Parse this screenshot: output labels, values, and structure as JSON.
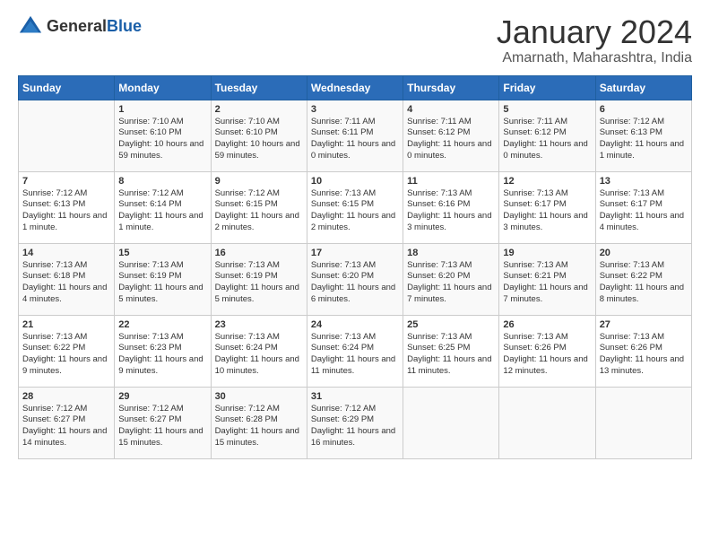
{
  "header": {
    "logo_line1": "General",
    "logo_line2": "Blue",
    "month": "January 2024",
    "location": "Amarnath, Maharashtra, India"
  },
  "weekdays": [
    "Sunday",
    "Monday",
    "Tuesday",
    "Wednesday",
    "Thursday",
    "Friday",
    "Saturday"
  ],
  "weeks": [
    [
      {
        "day": "",
        "sunrise": "",
        "sunset": "",
        "daylight": ""
      },
      {
        "day": "1",
        "sunrise": "Sunrise: 7:10 AM",
        "sunset": "Sunset: 6:10 PM",
        "daylight": "Daylight: 10 hours and 59 minutes."
      },
      {
        "day": "2",
        "sunrise": "Sunrise: 7:10 AM",
        "sunset": "Sunset: 6:10 PM",
        "daylight": "Daylight: 10 hours and 59 minutes."
      },
      {
        "day": "3",
        "sunrise": "Sunrise: 7:11 AM",
        "sunset": "Sunset: 6:11 PM",
        "daylight": "Daylight: 11 hours and 0 minutes."
      },
      {
        "day": "4",
        "sunrise": "Sunrise: 7:11 AM",
        "sunset": "Sunset: 6:12 PM",
        "daylight": "Daylight: 11 hours and 0 minutes."
      },
      {
        "day": "5",
        "sunrise": "Sunrise: 7:11 AM",
        "sunset": "Sunset: 6:12 PM",
        "daylight": "Daylight: 11 hours and 0 minutes."
      },
      {
        "day": "6",
        "sunrise": "Sunrise: 7:12 AM",
        "sunset": "Sunset: 6:13 PM",
        "daylight": "Daylight: 11 hours and 1 minute."
      }
    ],
    [
      {
        "day": "7",
        "sunrise": "Sunrise: 7:12 AM",
        "sunset": "Sunset: 6:13 PM",
        "daylight": "Daylight: 11 hours and 1 minute."
      },
      {
        "day": "8",
        "sunrise": "Sunrise: 7:12 AM",
        "sunset": "Sunset: 6:14 PM",
        "daylight": "Daylight: 11 hours and 1 minute."
      },
      {
        "day": "9",
        "sunrise": "Sunrise: 7:12 AM",
        "sunset": "Sunset: 6:15 PM",
        "daylight": "Daylight: 11 hours and 2 minutes."
      },
      {
        "day": "10",
        "sunrise": "Sunrise: 7:13 AM",
        "sunset": "Sunset: 6:15 PM",
        "daylight": "Daylight: 11 hours and 2 minutes."
      },
      {
        "day": "11",
        "sunrise": "Sunrise: 7:13 AM",
        "sunset": "Sunset: 6:16 PM",
        "daylight": "Daylight: 11 hours and 3 minutes."
      },
      {
        "day": "12",
        "sunrise": "Sunrise: 7:13 AM",
        "sunset": "Sunset: 6:17 PM",
        "daylight": "Daylight: 11 hours and 3 minutes."
      },
      {
        "day": "13",
        "sunrise": "Sunrise: 7:13 AM",
        "sunset": "Sunset: 6:17 PM",
        "daylight": "Daylight: 11 hours and 4 minutes."
      }
    ],
    [
      {
        "day": "14",
        "sunrise": "Sunrise: 7:13 AM",
        "sunset": "Sunset: 6:18 PM",
        "daylight": "Daylight: 11 hours and 4 minutes."
      },
      {
        "day": "15",
        "sunrise": "Sunrise: 7:13 AM",
        "sunset": "Sunset: 6:19 PM",
        "daylight": "Daylight: 11 hours and 5 minutes."
      },
      {
        "day": "16",
        "sunrise": "Sunrise: 7:13 AM",
        "sunset": "Sunset: 6:19 PM",
        "daylight": "Daylight: 11 hours and 5 minutes."
      },
      {
        "day": "17",
        "sunrise": "Sunrise: 7:13 AM",
        "sunset": "Sunset: 6:20 PM",
        "daylight": "Daylight: 11 hours and 6 minutes."
      },
      {
        "day": "18",
        "sunrise": "Sunrise: 7:13 AM",
        "sunset": "Sunset: 6:20 PM",
        "daylight": "Daylight: 11 hours and 7 minutes."
      },
      {
        "day": "19",
        "sunrise": "Sunrise: 7:13 AM",
        "sunset": "Sunset: 6:21 PM",
        "daylight": "Daylight: 11 hours and 7 minutes."
      },
      {
        "day": "20",
        "sunrise": "Sunrise: 7:13 AM",
        "sunset": "Sunset: 6:22 PM",
        "daylight": "Daylight: 11 hours and 8 minutes."
      }
    ],
    [
      {
        "day": "21",
        "sunrise": "Sunrise: 7:13 AM",
        "sunset": "Sunset: 6:22 PM",
        "daylight": "Daylight: 11 hours and 9 minutes."
      },
      {
        "day": "22",
        "sunrise": "Sunrise: 7:13 AM",
        "sunset": "Sunset: 6:23 PM",
        "daylight": "Daylight: 11 hours and 9 minutes."
      },
      {
        "day": "23",
        "sunrise": "Sunrise: 7:13 AM",
        "sunset": "Sunset: 6:24 PM",
        "daylight": "Daylight: 11 hours and 10 minutes."
      },
      {
        "day": "24",
        "sunrise": "Sunrise: 7:13 AM",
        "sunset": "Sunset: 6:24 PM",
        "daylight": "Daylight: 11 hours and 11 minutes."
      },
      {
        "day": "25",
        "sunrise": "Sunrise: 7:13 AM",
        "sunset": "Sunset: 6:25 PM",
        "daylight": "Daylight: 11 hours and 11 minutes."
      },
      {
        "day": "26",
        "sunrise": "Sunrise: 7:13 AM",
        "sunset": "Sunset: 6:26 PM",
        "daylight": "Daylight: 11 hours and 12 minutes."
      },
      {
        "day": "27",
        "sunrise": "Sunrise: 7:13 AM",
        "sunset": "Sunset: 6:26 PM",
        "daylight": "Daylight: 11 hours and 13 minutes."
      }
    ],
    [
      {
        "day": "28",
        "sunrise": "Sunrise: 7:12 AM",
        "sunset": "Sunset: 6:27 PM",
        "daylight": "Daylight: 11 hours and 14 minutes."
      },
      {
        "day": "29",
        "sunrise": "Sunrise: 7:12 AM",
        "sunset": "Sunset: 6:27 PM",
        "daylight": "Daylight: 11 hours and 15 minutes."
      },
      {
        "day": "30",
        "sunrise": "Sunrise: 7:12 AM",
        "sunset": "Sunset: 6:28 PM",
        "daylight": "Daylight: 11 hours and 15 minutes."
      },
      {
        "day": "31",
        "sunrise": "Sunrise: 7:12 AM",
        "sunset": "Sunset: 6:29 PM",
        "daylight": "Daylight: 11 hours and 16 minutes."
      },
      {
        "day": "",
        "sunrise": "",
        "sunset": "",
        "daylight": ""
      },
      {
        "day": "",
        "sunrise": "",
        "sunset": "",
        "daylight": ""
      },
      {
        "day": "",
        "sunrise": "",
        "sunset": "",
        "daylight": ""
      }
    ]
  ]
}
